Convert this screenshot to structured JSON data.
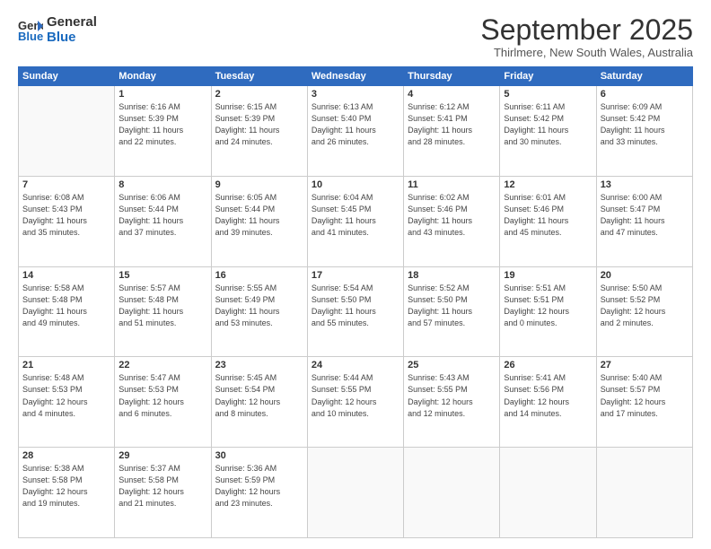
{
  "logo": {
    "line1": "General",
    "line2": "Blue"
  },
  "header": {
    "month": "September 2025",
    "location": "Thirlmere, New South Wales, Australia"
  },
  "weekdays": [
    "Sunday",
    "Monday",
    "Tuesday",
    "Wednesday",
    "Thursday",
    "Friday",
    "Saturday"
  ],
  "weeks": [
    [
      {
        "day": "",
        "info": ""
      },
      {
        "day": "1",
        "info": "Sunrise: 6:16 AM\nSunset: 5:39 PM\nDaylight: 11 hours\nand 22 minutes."
      },
      {
        "day": "2",
        "info": "Sunrise: 6:15 AM\nSunset: 5:39 PM\nDaylight: 11 hours\nand 24 minutes."
      },
      {
        "day": "3",
        "info": "Sunrise: 6:13 AM\nSunset: 5:40 PM\nDaylight: 11 hours\nand 26 minutes."
      },
      {
        "day": "4",
        "info": "Sunrise: 6:12 AM\nSunset: 5:41 PM\nDaylight: 11 hours\nand 28 minutes."
      },
      {
        "day": "5",
        "info": "Sunrise: 6:11 AM\nSunset: 5:42 PM\nDaylight: 11 hours\nand 30 minutes."
      },
      {
        "day": "6",
        "info": "Sunrise: 6:09 AM\nSunset: 5:42 PM\nDaylight: 11 hours\nand 33 minutes."
      }
    ],
    [
      {
        "day": "7",
        "info": "Sunrise: 6:08 AM\nSunset: 5:43 PM\nDaylight: 11 hours\nand 35 minutes."
      },
      {
        "day": "8",
        "info": "Sunrise: 6:06 AM\nSunset: 5:44 PM\nDaylight: 11 hours\nand 37 minutes."
      },
      {
        "day": "9",
        "info": "Sunrise: 6:05 AM\nSunset: 5:44 PM\nDaylight: 11 hours\nand 39 minutes."
      },
      {
        "day": "10",
        "info": "Sunrise: 6:04 AM\nSunset: 5:45 PM\nDaylight: 11 hours\nand 41 minutes."
      },
      {
        "day": "11",
        "info": "Sunrise: 6:02 AM\nSunset: 5:46 PM\nDaylight: 11 hours\nand 43 minutes."
      },
      {
        "day": "12",
        "info": "Sunrise: 6:01 AM\nSunset: 5:46 PM\nDaylight: 11 hours\nand 45 minutes."
      },
      {
        "day": "13",
        "info": "Sunrise: 6:00 AM\nSunset: 5:47 PM\nDaylight: 11 hours\nand 47 minutes."
      }
    ],
    [
      {
        "day": "14",
        "info": "Sunrise: 5:58 AM\nSunset: 5:48 PM\nDaylight: 11 hours\nand 49 minutes."
      },
      {
        "day": "15",
        "info": "Sunrise: 5:57 AM\nSunset: 5:48 PM\nDaylight: 11 hours\nand 51 minutes."
      },
      {
        "day": "16",
        "info": "Sunrise: 5:55 AM\nSunset: 5:49 PM\nDaylight: 11 hours\nand 53 minutes."
      },
      {
        "day": "17",
        "info": "Sunrise: 5:54 AM\nSunset: 5:50 PM\nDaylight: 11 hours\nand 55 minutes."
      },
      {
        "day": "18",
        "info": "Sunrise: 5:52 AM\nSunset: 5:50 PM\nDaylight: 11 hours\nand 57 minutes."
      },
      {
        "day": "19",
        "info": "Sunrise: 5:51 AM\nSunset: 5:51 PM\nDaylight: 12 hours\nand 0 minutes."
      },
      {
        "day": "20",
        "info": "Sunrise: 5:50 AM\nSunset: 5:52 PM\nDaylight: 12 hours\nand 2 minutes."
      }
    ],
    [
      {
        "day": "21",
        "info": "Sunrise: 5:48 AM\nSunset: 5:53 PM\nDaylight: 12 hours\nand 4 minutes."
      },
      {
        "day": "22",
        "info": "Sunrise: 5:47 AM\nSunset: 5:53 PM\nDaylight: 12 hours\nand 6 minutes."
      },
      {
        "day": "23",
        "info": "Sunrise: 5:45 AM\nSunset: 5:54 PM\nDaylight: 12 hours\nand 8 minutes."
      },
      {
        "day": "24",
        "info": "Sunrise: 5:44 AM\nSunset: 5:55 PM\nDaylight: 12 hours\nand 10 minutes."
      },
      {
        "day": "25",
        "info": "Sunrise: 5:43 AM\nSunset: 5:55 PM\nDaylight: 12 hours\nand 12 minutes."
      },
      {
        "day": "26",
        "info": "Sunrise: 5:41 AM\nSunset: 5:56 PM\nDaylight: 12 hours\nand 14 minutes."
      },
      {
        "day": "27",
        "info": "Sunrise: 5:40 AM\nSunset: 5:57 PM\nDaylight: 12 hours\nand 17 minutes."
      }
    ],
    [
      {
        "day": "28",
        "info": "Sunrise: 5:38 AM\nSunset: 5:58 PM\nDaylight: 12 hours\nand 19 minutes."
      },
      {
        "day": "29",
        "info": "Sunrise: 5:37 AM\nSunset: 5:58 PM\nDaylight: 12 hours\nand 21 minutes."
      },
      {
        "day": "30",
        "info": "Sunrise: 5:36 AM\nSunset: 5:59 PM\nDaylight: 12 hours\nand 23 minutes."
      },
      {
        "day": "",
        "info": ""
      },
      {
        "day": "",
        "info": ""
      },
      {
        "day": "",
        "info": ""
      },
      {
        "day": "",
        "info": ""
      }
    ]
  ]
}
